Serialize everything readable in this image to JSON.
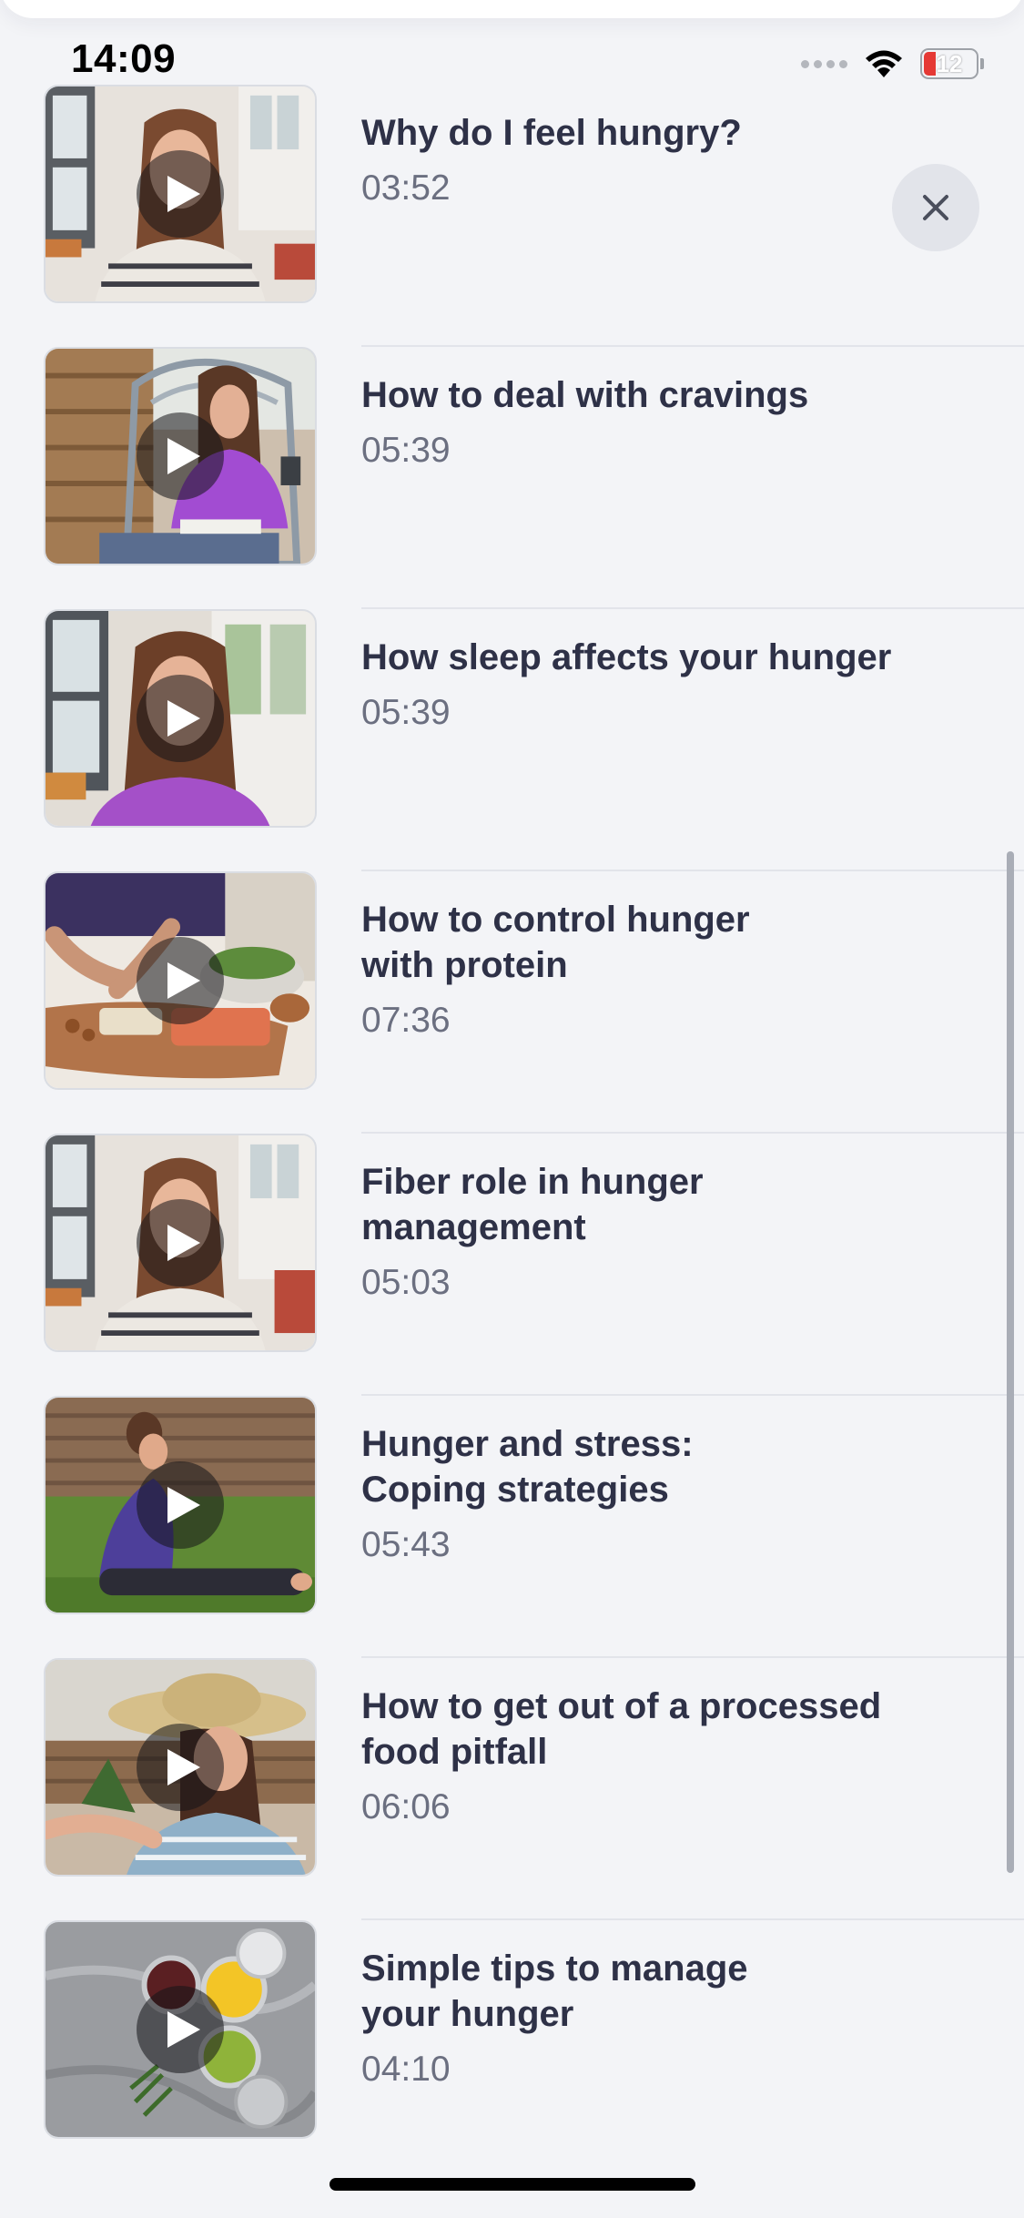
{
  "status_bar": {
    "time": "14:09",
    "battery_level": "12",
    "icons": [
      "cellular-signal-icon",
      "wifi-icon",
      "battery-icon"
    ]
  },
  "close_button": {
    "icon": "close-icon"
  },
  "videos": [
    {
      "title": "Why do I feel hungry?",
      "duration": "03:52",
      "thumbnail": "woman-kitchen"
    },
    {
      "title": "How to deal with cravings",
      "duration": "05:39",
      "thumbnail": "woman-patio-chair"
    },
    {
      "title": "How sleep affects your hunger",
      "duration": "05:39",
      "thumbnail": "woman-window"
    },
    {
      "title": "How to control hunger\nwith protein",
      "duration": "07:36",
      "thumbnail": "cutting-board"
    },
    {
      "title": "Fiber role in hunger\nmanagement",
      "duration": "05:03",
      "thumbnail": "woman-kitchen"
    },
    {
      "title": "Hunger and stress:\nCoping strategies",
      "duration": "05:43",
      "thumbnail": "woman-stretching-grass"
    },
    {
      "title": "How to get out of a processed\nfood pitfall",
      "duration": "06:06",
      "thumbnail": "woman-gardening-hat"
    },
    {
      "title": "Simple tips to manage\nyour hunger",
      "duration": "04:10",
      "thumbnail": "canned-vegetables"
    }
  ],
  "colors": {
    "background": "#f3f4f7",
    "title_text": "#2e3147",
    "duration_text": "#6b6f80",
    "divider": "#e2e4ea",
    "battery_low": "#e53935"
  }
}
